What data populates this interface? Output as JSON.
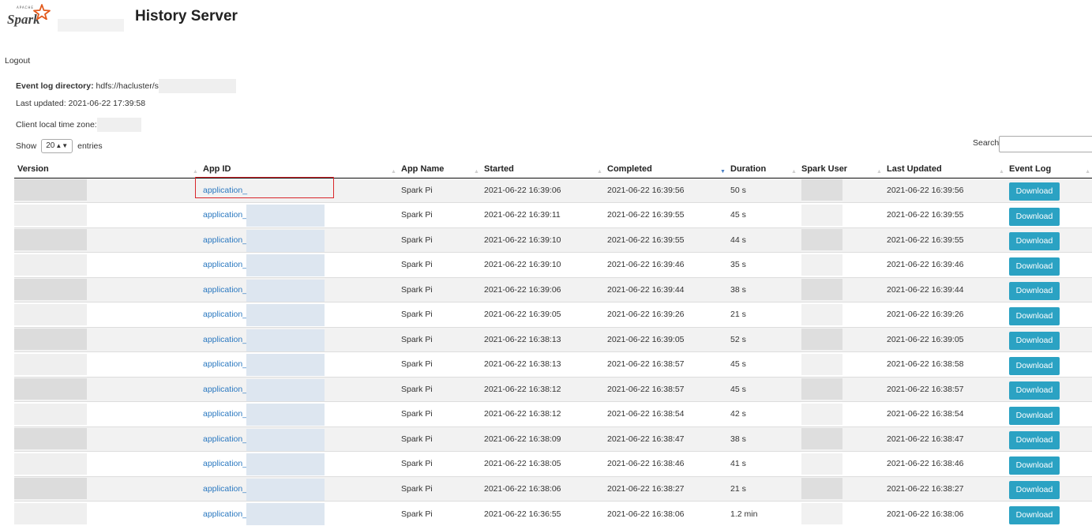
{
  "header": {
    "logo_apache": "APACHE",
    "logo_text": "Spark",
    "title": "History Server"
  },
  "nav": {
    "logout": "Logout"
  },
  "info": {
    "event_log_label": "Event log directory:",
    "event_log_value": "hdfs://hacluster/s",
    "last_updated": "Last updated: 2021-06-22 17:39:58",
    "timezone_label": "Client local time zone:"
  },
  "controls": {
    "show_label": "Show",
    "show_value": "20",
    "entries_label": "entries",
    "search_label": "Search:"
  },
  "table": {
    "columns": [
      "Version",
      "App ID",
      "App Name",
      "Started",
      "Completed",
      "Duration",
      "Spark User",
      "Last Updated",
      "Event Log"
    ],
    "sorted_column": "Duration",
    "rows": [
      {
        "app_id": "application_",
        "app_name": "Spark Pi",
        "started": "2021-06-22 16:39:06",
        "completed": "2021-06-22 16:39:56",
        "duration": "50 s",
        "last_updated": "2021-06-22 16:39:56",
        "event_log": "Download"
      },
      {
        "app_id": "application_",
        "app_name": "Spark Pi",
        "started": "2021-06-22 16:39:11",
        "completed": "2021-06-22 16:39:55",
        "duration": "45 s",
        "last_updated": "2021-06-22 16:39:55",
        "event_log": "Download"
      },
      {
        "app_id": "application_",
        "app_name": "Spark Pi",
        "started": "2021-06-22 16:39:10",
        "completed": "2021-06-22 16:39:55",
        "duration": "44 s",
        "last_updated": "2021-06-22 16:39:55",
        "event_log": "Download"
      },
      {
        "app_id": "application_",
        "app_name": "Spark Pi",
        "started": "2021-06-22 16:39:10",
        "completed": "2021-06-22 16:39:46",
        "duration": "35 s",
        "last_updated": "2021-06-22 16:39:46",
        "event_log": "Download"
      },
      {
        "app_id": "application_",
        "app_name": "Spark Pi",
        "started": "2021-06-22 16:39:06",
        "completed": "2021-06-22 16:39:44",
        "duration": "38 s",
        "last_updated": "2021-06-22 16:39:44",
        "event_log": "Download"
      },
      {
        "app_id": "application_",
        "app_name": "Spark Pi",
        "started": "2021-06-22 16:39:05",
        "completed": "2021-06-22 16:39:26",
        "duration": "21 s",
        "last_updated": "2021-06-22 16:39:26",
        "event_log": "Download"
      },
      {
        "app_id": "application_",
        "app_name": "Spark Pi",
        "started": "2021-06-22 16:38:13",
        "completed": "2021-06-22 16:39:05",
        "duration": "52 s",
        "last_updated": "2021-06-22 16:39:05",
        "event_log": "Download"
      },
      {
        "app_id": "application_",
        "app_name": "Spark Pi",
        "started": "2021-06-22 16:38:13",
        "completed": "2021-06-22 16:38:57",
        "duration": "45 s",
        "last_updated": "2021-06-22 16:38:58",
        "event_log": "Download"
      },
      {
        "app_id": "application_",
        "app_name": "Spark Pi",
        "started": "2021-06-22 16:38:12",
        "completed": "2021-06-22 16:38:57",
        "duration": "45 s",
        "last_updated": "2021-06-22 16:38:57",
        "event_log": "Download"
      },
      {
        "app_id": "application_",
        "app_name": "Spark Pi",
        "started": "2021-06-22 16:38:12",
        "completed": "2021-06-22 16:38:54",
        "duration": "42 s",
        "last_updated": "2021-06-22 16:38:54",
        "event_log": "Download"
      },
      {
        "app_id": "application_",
        "app_name": "Spark Pi",
        "started": "2021-06-22 16:38:09",
        "completed": "2021-06-22 16:38:47",
        "duration": "38 s",
        "last_updated": "2021-06-22 16:38:47",
        "event_log": "Download"
      },
      {
        "app_id": "application_",
        "app_name": "Spark Pi",
        "started": "2021-06-22 16:38:05",
        "completed": "2021-06-22 16:38:46",
        "duration": "41 s",
        "last_updated": "2021-06-22 16:38:46",
        "event_log": "Download"
      },
      {
        "app_id": "application_",
        "app_name": "Spark Pi",
        "started": "2021-06-22 16:38:06",
        "completed": "2021-06-22 16:38:27",
        "duration": "21 s",
        "last_updated": "2021-06-22 16:38:27",
        "event_log": "Download"
      },
      {
        "app_id": "application_",
        "app_name": "Spark Pi",
        "started": "2021-06-22 16:36:55",
        "completed": "2021-06-22 16:38:06",
        "duration": "1.2 min",
        "last_updated": "2021-06-22 16:38:06",
        "event_log": "Download"
      }
    ]
  },
  "colors": {
    "link": "#2a78c0",
    "button": "#2ba2c3",
    "highlight_border": "#d9262b",
    "stripe": "#f2f2f2"
  }
}
